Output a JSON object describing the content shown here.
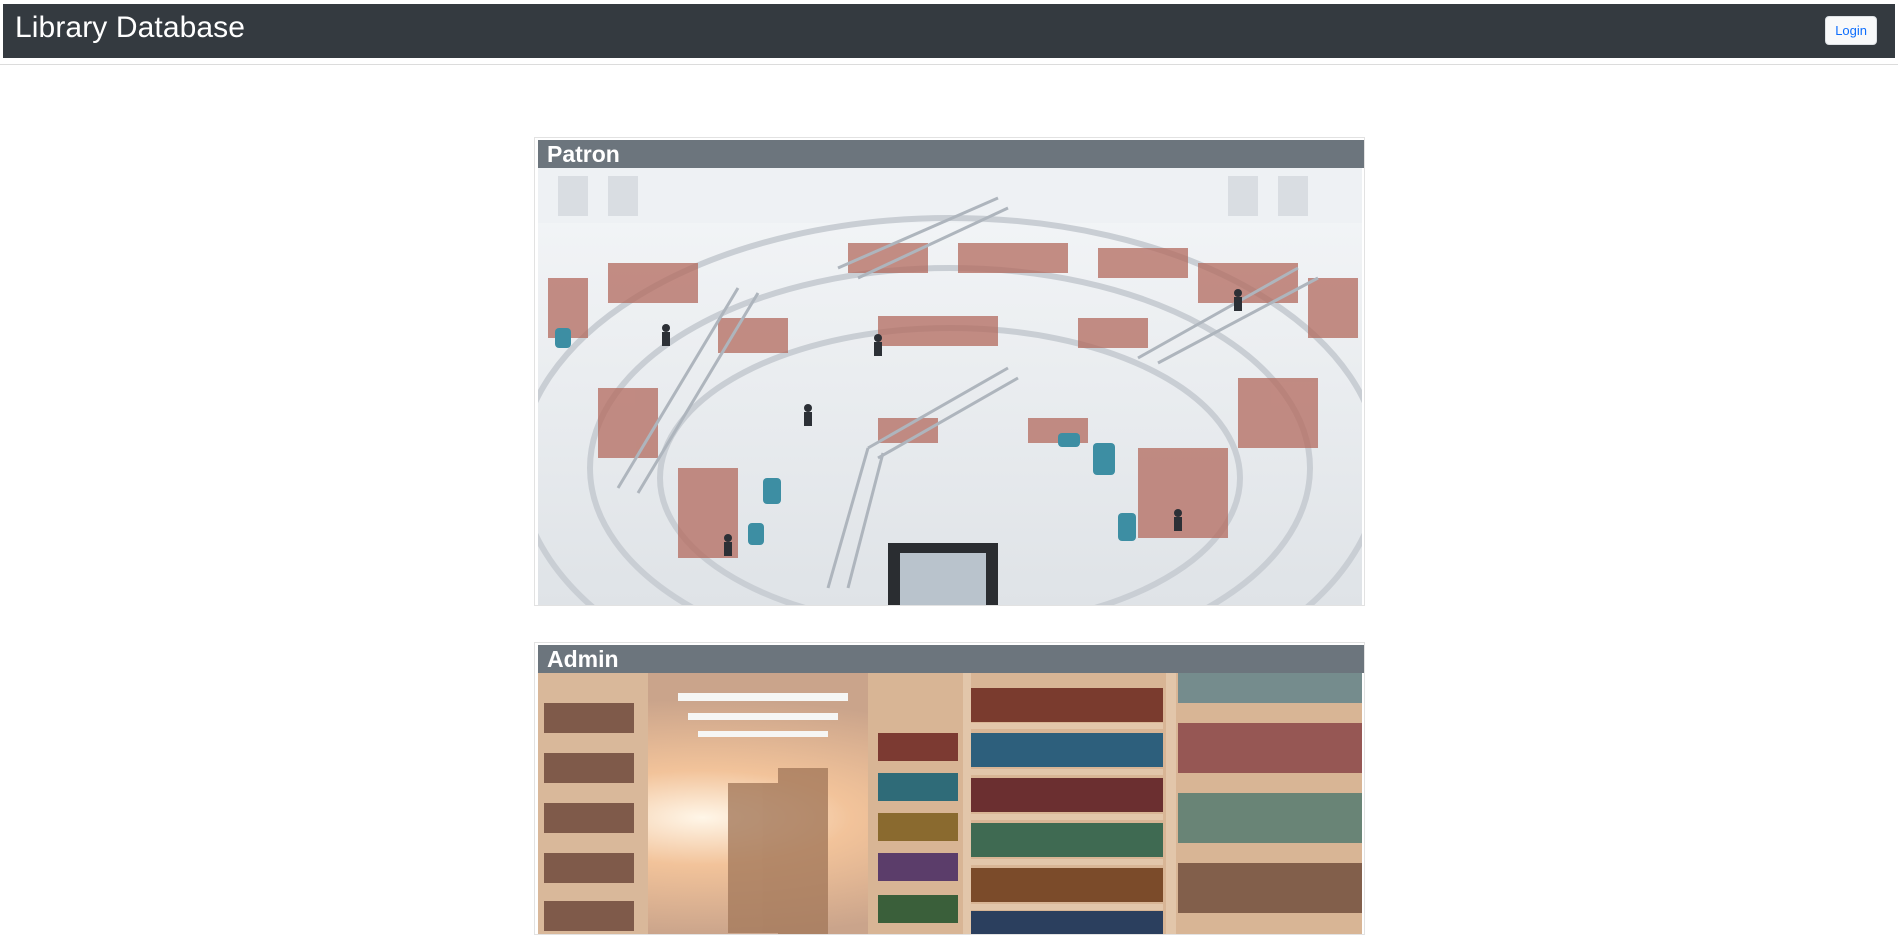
{
  "navbar": {
    "brand": "Library Database",
    "login_label": "Login"
  },
  "cards": [
    {
      "title": "Patron",
      "image_description": "library-atrium-photo"
    },
    {
      "title": "Admin",
      "image_description": "library-bookshelves-photo"
    }
  ],
  "colors": {
    "navbar_bg": "#343a40",
    "card_header_bg": "#6c757d",
    "login_text": "#0d6efd"
  }
}
